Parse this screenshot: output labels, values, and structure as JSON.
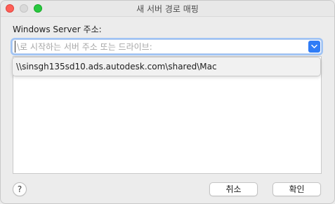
{
  "window": {
    "title": "새 서버 경로 매핑"
  },
  "form": {
    "label": "Windows Server 주소:",
    "input_value": "",
    "input_placeholder": "\\로 시작하는 서버 주소 또는 드라이브:"
  },
  "dropdown": {
    "items": [
      "\\\\sinsgh135sd10.ads.autodesk.com\\shared\\Mac"
    ]
  },
  "footer": {
    "help_label": "?",
    "cancel_label": "취소",
    "ok_label": "확인"
  },
  "colors": {
    "accent": "#2f7cf6",
    "close": "#fe5f57",
    "maximize": "#28c840"
  },
  "icons": {
    "combo_arrow": "chevron-down-icon"
  }
}
